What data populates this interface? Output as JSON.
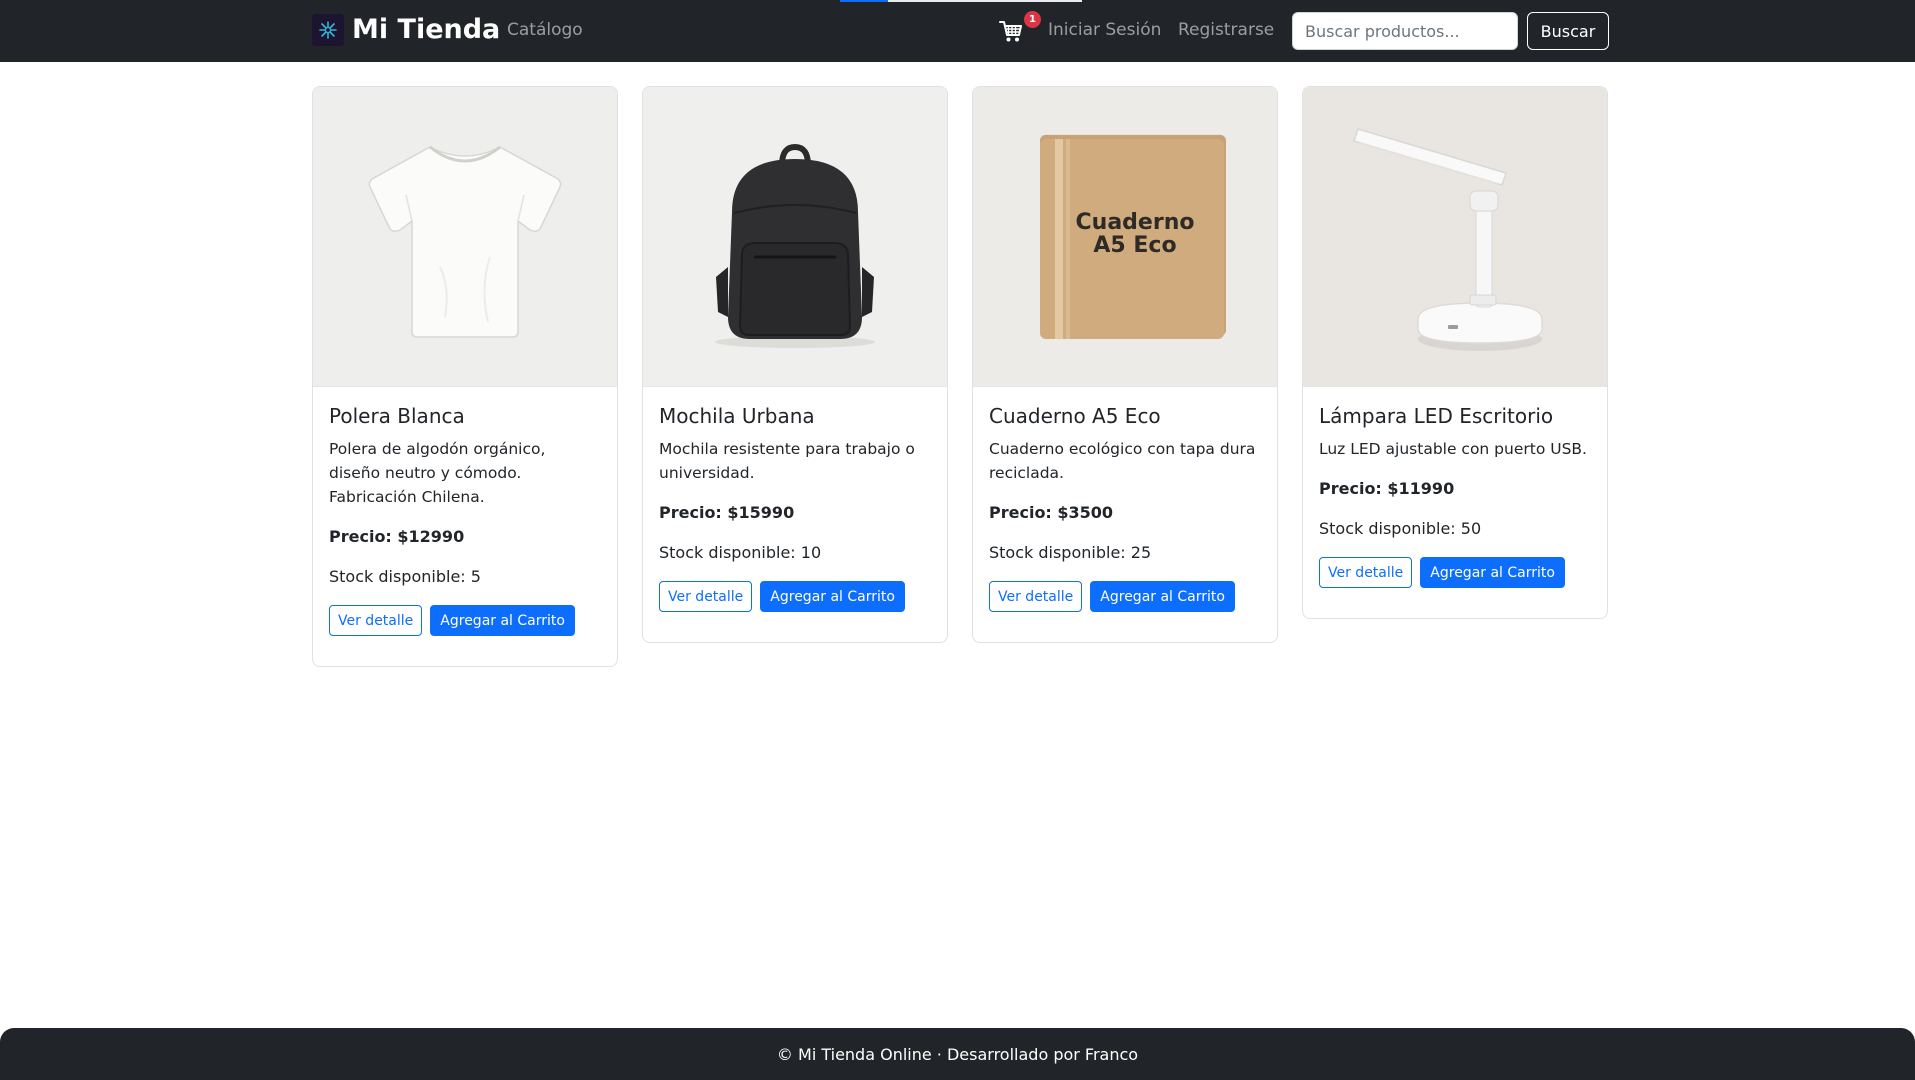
{
  "navbar": {
    "brand": "Mi Tienda",
    "links": {
      "catalogo": "Catálogo",
      "login": "Iniciar Sesión",
      "register": "Registrarse"
    },
    "cart_count": "1",
    "search": {
      "placeholder": "Buscar productos...",
      "value": "",
      "button_label": "Buscar"
    }
  },
  "products": [
    {
      "title": "Polera Blanca",
      "description": "Polera de algodón orgánico, diseño neutro y cómodo. Fabricación Chilena.",
      "price": "Precio: $12990",
      "stock": "Stock disponible: 5",
      "detail_label": "Ver detalle",
      "add_label": "Agregar al Carrito",
      "image_icon": "t-shirt-image"
    },
    {
      "title": "Mochila Urbana",
      "description": "Mochila resistente para trabajo o universidad.",
      "price": "Precio: $15990",
      "stock": "Stock disponible: 10",
      "detail_label": "Ver detalle",
      "add_label": "Agregar al Carrito",
      "image_icon": "backpack-image"
    },
    {
      "title": "Cuaderno A5 Eco",
      "description": "Cuaderno ecológico con tapa dura reciclada.",
      "price": "Precio: $3500",
      "stock": "Stock disponible: 25",
      "detail_label": "Ver detalle",
      "add_label": "Agregar al Carrito",
      "image_icon": "notebook-image",
      "image_text_line1": "Cuaderno",
      "image_text_line2": "A5 Eco"
    },
    {
      "title": "Lámpara LED Escritorio",
      "description": "Luz LED ajustable con puerto USB.",
      "price": "Precio: $11990",
      "stock": "Stock disponible: 50",
      "detail_label": "Ver detalle",
      "add_label": "Agregar al Carrito",
      "image_icon": "desk-lamp-image"
    }
  ],
  "footer": {
    "text": "© Mi Tienda Online · Desarrollado por Franco"
  },
  "colors": {
    "navbar": "#212529",
    "primary": "#0d6efd",
    "badge": "#dc3545"
  }
}
